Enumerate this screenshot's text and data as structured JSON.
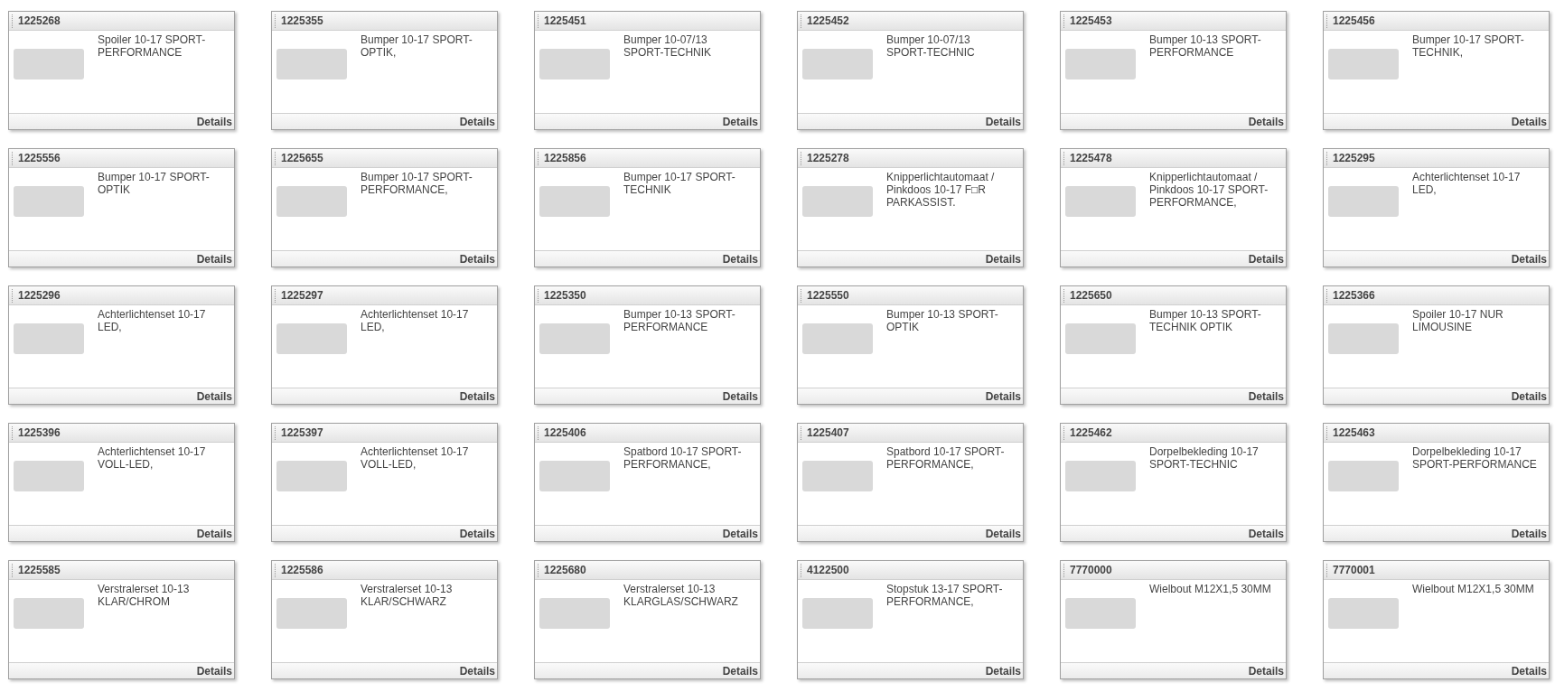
{
  "products": [
    {
      "id": "1225268",
      "description": "Spoiler 10-17 SPORT-PERFORMANCE",
      "link": "Details"
    },
    {
      "id": "1225355",
      "description": "Bumper 10-17 SPORT-OPTIK,",
      "link": "Details"
    },
    {
      "id": "1225451",
      "description": "Bumper 10-07/13 SPORT-TECHNIK",
      "link": "Details"
    },
    {
      "id": "1225452",
      "description": "Bumper 10-07/13 SPORT-TECHNIC",
      "link": "Details"
    },
    {
      "id": "1225453",
      "description": "Bumper 10-13 SPORT-PERFORMANCE",
      "link": "Details"
    },
    {
      "id": "1225456",
      "description": "Bumper 10-17 SPORT-TECHNIK,",
      "link": "Details"
    },
    {
      "id": "1225556",
      "description": "Bumper 10-17 SPORT-OPTIK",
      "link": "Details"
    },
    {
      "id": "1225655",
      "description": "Bumper 10-17 SPORT-PERFORMANCE,",
      "link": "Details"
    },
    {
      "id": "1225856",
      "description": "Bumper 10-17 SPORT-TECHNIK",
      "link": "Details"
    },
    {
      "id": "1225278",
      "description": "Knipperlichtautomaat / Pinkdoos 10-17 F□R PARKASSIST.",
      "link": "Details"
    },
    {
      "id": "1225478",
      "description": "Knipperlichtautomaat / Pinkdoos 10-17 SPORT-PERFORMANCE,",
      "link": "Details"
    },
    {
      "id": "1225295",
      "description": "Achterlichtenset 10-17 LED,",
      "link": "Details"
    },
    {
      "id": "1225296",
      "description": "Achterlichtenset 10-17 LED,",
      "link": "Details"
    },
    {
      "id": "1225297",
      "description": "Achterlichtenset 10-17 LED,",
      "link": "Details"
    },
    {
      "id": "1225350",
      "description": "Bumper 10-13 SPORT-PERFORMANCE",
      "link": "Details"
    },
    {
      "id": "1225550",
      "description": "Bumper 10-13 SPORT-OPTIK",
      "link": "Details"
    },
    {
      "id": "1225650",
      "description": "Bumper 10-13 SPORT-TECHNIK OPTIK",
      "link": "Details"
    },
    {
      "id": "1225366",
      "description": "Spoiler 10-17 NUR LIMOUSINE",
      "link": "Details"
    },
    {
      "id": "1225396",
      "description": "Achterlichtenset 10-17 VOLL-LED,",
      "link": "Details"
    },
    {
      "id": "1225397",
      "description": "Achterlichtenset 10-17 VOLL-LED,",
      "link": "Details"
    },
    {
      "id": "1225406",
      "description": "Spatbord 10-17 SPORT-PERFORMANCE,",
      "link": "Details"
    },
    {
      "id": "1225407",
      "description": "Spatbord 10-17 SPORT-PERFORMANCE,",
      "link": "Details"
    },
    {
      "id": "1225462",
      "description": "Dorpelbekleding 10-17 SPORT-TECHNIC",
      "link": "Details"
    },
    {
      "id": "1225463",
      "description": "Dorpelbekleding 10-17 SPORT-PERFORMANCE",
      "link": "Details"
    },
    {
      "id": "1225585",
      "description": "Verstralerset 10-13 KLAR/CHROM",
      "link": "Details"
    },
    {
      "id": "1225586",
      "description": "Verstralerset 10-13 KLAR/SCHWARZ",
      "link": "Details"
    },
    {
      "id": "1225680",
      "description": "Verstralerset 10-13 KLARGLAS/SCHWARZ",
      "link": "Details"
    },
    {
      "id": "4122500",
      "description": "Stopstuk 13-17 SPORT-PERFORMANCE,",
      "link": "Details"
    },
    {
      "id": "7770000",
      "description": "Wielbout M12X1,5 30MM",
      "link": "Details"
    },
    {
      "id": "7770001",
      "description": "Wielbout M12X1,5 30MM",
      "link": "Details"
    }
  ]
}
